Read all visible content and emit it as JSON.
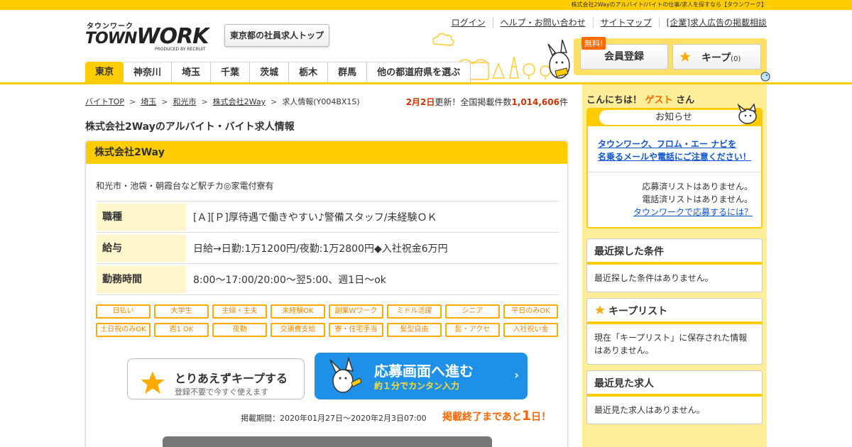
{
  "header": {
    "tagline": "株式会社2Wayのアルバイト/バイトの仕事/求人を探すなら【タウンワーク】",
    "logo_kana": "タウンワーク",
    "logo_town": "TOWN",
    "logo_work": "WORK",
    "logo_produced": "PRODUCED BY RECRUIT",
    "top_button": "東京都の社員求人トップ",
    "links": [
      "ログイン",
      "ヘルプ・お問い合わせ",
      "サイトマップ",
      "[企業]求人広告の掲載相談"
    ],
    "free_badge": "無料!",
    "member_button": "会員登録",
    "keep_button": "キープ",
    "keep_count": "(0)"
  },
  "nav": {
    "tabs": [
      "東京",
      "神奈川",
      "埼玉",
      "千葉",
      "茨城",
      "栃木",
      "群馬",
      "他の都道府県を選ぶ"
    ]
  },
  "breadcrumb": {
    "items": [
      "バイトTOP",
      "埼玉",
      "和光市",
      "株式会社2Way"
    ],
    "current": "求人情報(Y004BX1S)"
  },
  "update": {
    "date": "2月2日",
    "text": "更新！全国掲載件数",
    "count": "1,014,606",
    "unit": "件"
  },
  "page_title": "株式会社2Wayのアルバイト・バイト求人情報",
  "job": {
    "company": "株式会社2Way",
    "catch": "和光市・池袋・朝霞台など駅チカ◎家電付寮有",
    "rows": [
      {
        "label": "職種",
        "value": "[Ａ][Ｐ]厚待遇で働きやすい♪警備スタッフ/未経験ＯＫ"
      },
      {
        "label": "給与",
        "value": "日給→日勤:1万1200円/夜勤:1万2800円◆入社祝金6万円"
      },
      {
        "label": "勤務時間",
        "value": "8:00～17:00/20:00～翌5:00、週1日～ok"
      }
    ],
    "tags": [
      "日払い",
      "大学生",
      "主婦・主夫",
      "未経験OK",
      "副業Wワーク",
      "ミドル活躍",
      "シニア",
      "平日のみOK",
      "土日祝のみOK",
      "週1 OK",
      "夜勤",
      "交通費支給",
      "寮・住宅手当",
      "髪型自由",
      "髭・アクセ",
      "入社祝い金"
    ],
    "keep_button": {
      "title": "とりあえずキープする",
      "sub": "登録不要で今すぐ使えます"
    },
    "apply_button": {
      "title": "応募画面へ進む",
      "sub": "約１分でカンタン入力"
    },
    "period": "掲載期間：2020年01月27日～2020年2月3日07:00",
    "remain_prefix": "掲載終了まであと",
    "remain_num": "1",
    "remain_suffix": "日！"
  },
  "sidebar": {
    "hello_prefix": "こんにちは！",
    "hello_name": "ゲスト",
    "hello_suffix": "さん",
    "notice_title": "お知らせ",
    "notice_link_1": "タウンワーク、フロム・エー ナビを",
    "notice_link_2": "名乗るメールや電話にご注意ください！",
    "status_1": "応募済リストはありません。",
    "status_2": "電話済リストはありません。",
    "status_link": "タウンワークで応募するには？",
    "recent_search_title": "最近探した条件",
    "recent_search_body": "最近探した条件はありません。",
    "keep_list_title": "キープリスト",
    "keep_list_body": "現在「キープリスト」に保存された情報はありません。",
    "recent_view_title": "最近見た求人",
    "recent_view_body": "最近見た求人はありません。"
  },
  "colors": {
    "brand_yellow": "#ffcc00",
    "apply_blue": "#1e90e8",
    "accent_orange": "#ff6600"
  }
}
